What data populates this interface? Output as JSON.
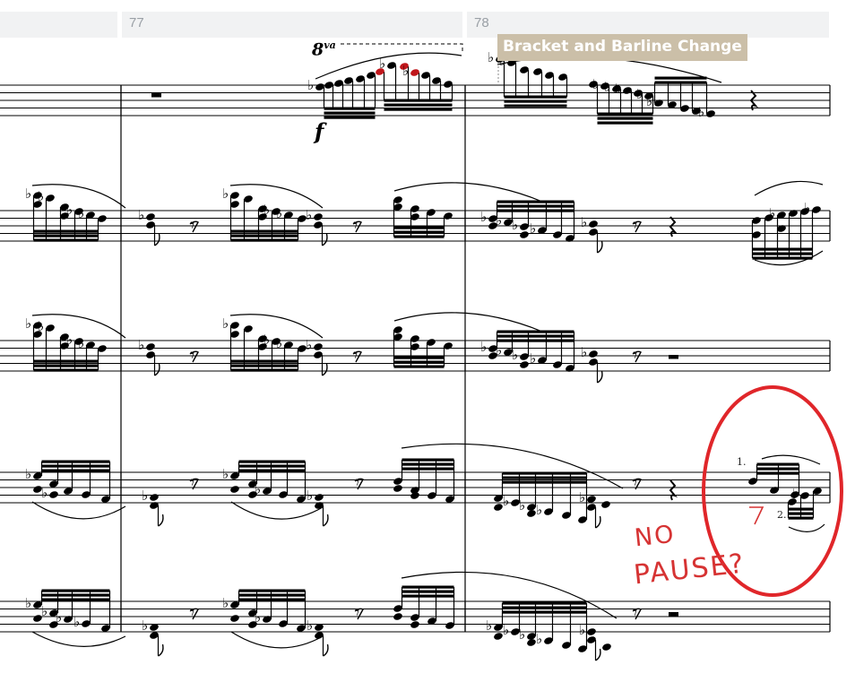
{
  "measures": [
    {
      "number": "",
      "id": "prev"
    },
    {
      "number": "77",
      "id": "m77"
    },
    {
      "number": "78",
      "id": "m78"
    }
  ],
  "overlay_label": "Bracket and Barline Change",
  "ottava": {
    "base": "8",
    "suffix": "va"
  },
  "dynamic": "f",
  "volta": {
    "first": "1.",
    "second": "2."
  },
  "annotation": {
    "line1": "NO",
    "line2": "PAUSE?",
    "circle_color": "#e0262a",
    "ink_color": "#d63333"
  },
  "highlight_note_color": "#c0161b",
  "staff_count": 5
}
